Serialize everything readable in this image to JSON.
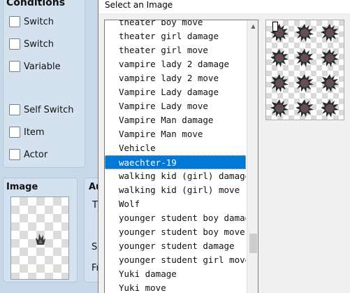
{
  "background_panel": {
    "conditions_title": "Conditions",
    "conditions": [
      {
        "label": "Switch",
        "checked": false
      },
      {
        "label": "Switch",
        "checked": false
      },
      {
        "label": "Variable",
        "checked": false
      },
      {
        "label": "Self Switch",
        "checked": false
      },
      {
        "label": "Item",
        "checked": false
      },
      {
        "label": "Actor",
        "checked": false
      }
    ],
    "image_title": "Image",
    "autonomous_title": "Au",
    "side_letters": [
      "T",
      "Sp",
      "Fr"
    ]
  },
  "dialog": {
    "title": "Select an Image",
    "list_items": [
      "theater boy move",
      "theater girl damage",
      "theater girl move",
      "vampire lady 2 damage",
      "vampire lady 2 move",
      "Vampire Lady damage",
      "Vampire Lady move",
      "Vampire Man damage",
      "Vampire Man move",
      "Vehicle",
      "waechter-19",
      "walking kid (girl) damage",
      "walking kid (girl) move",
      "Wolf",
      "younger student boy damage",
      "younger student boy move",
      "younger student damage",
      "younger student girl move",
      "Yuki damage",
      "Yuki move"
    ],
    "selected_item": "waechter-19",
    "scroll_position": 0.88,
    "colors": {
      "selection": "#0078d7",
      "selection_text": "#ffffff"
    },
    "preview_icons": "spiky-creature-icon"
  }
}
